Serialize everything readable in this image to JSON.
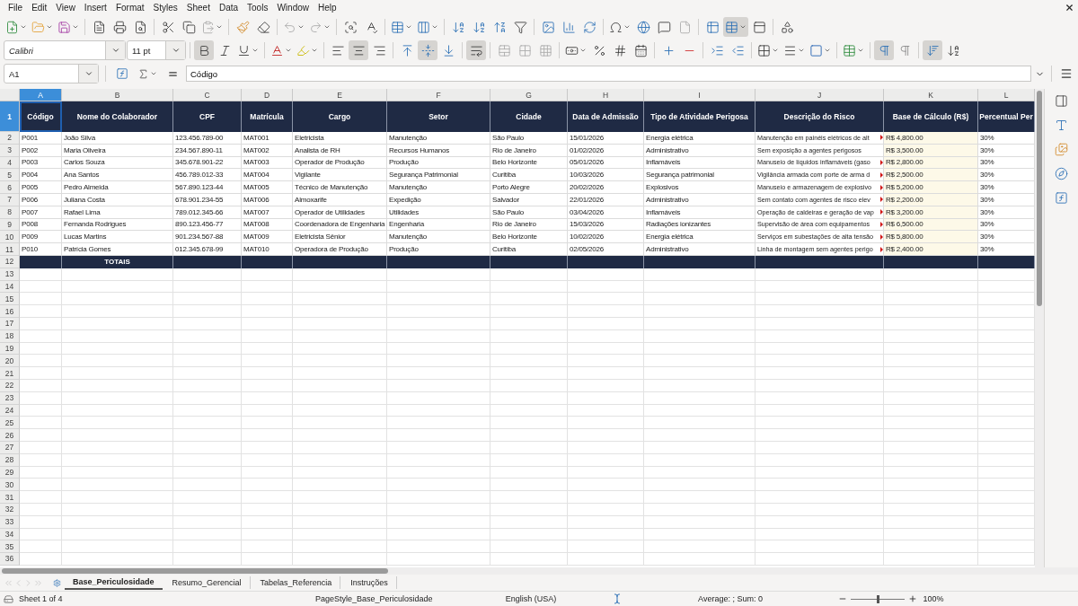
{
  "menu": [
    "File",
    "Edit",
    "View",
    "Insert",
    "Format",
    "Styles",
    "Sheet",
    "Data",
    "Tools",
    "Window",
    "Help"
  ],
  "format": {
    "font": "Calibri",
    "size": "11 pt",
    "bold": true,
    "italic": false,
    "underline": false,
    "align_center": true,
    "valign_middle": true,
    "wrap_text": true,
    "left_to_right": true
  },
  "name_box": "A1",
  "formula": "Código",
  "columns": [
    {
      "label": "A",
      "selected": true
    },
    {
      "label": "B",
      "selected": false
    },
    {
      "label": "C",
      "selected": false
    },
    {
      "label": "D",
      "selected": false
    },
    {
      "label": "E",
      "selected": false
    },
    {
      "label": "F",
      "selected": false
    },
    {
      "label": "G",
      "selected": false
    },
    {
      "label": "H",
      "selected": false
    },
    {
      "label": "I",
      "selected": false
    },
    {
      "label": "J",
      "selected": false
    },
    {
      "label": "K",
      "selected": false
    },
    {
      "label": "L",
      "selected": false
    }
  ],
  "header_row": {
    "number": "1",
    "selected": true,
    "cells": [
      "Código",
      "Nome do Colaborador",
      "CPF",
      "Matrícula",
      "Cargo",
      "Setor",
      "Cidade",
      "Data de Admissão",
      "Tipo de Atividade Perigosa",
      "Descrição do Risco",
      "Base de Cálculo (R$)",
      "Percentual Per"
    ]
  },
  "rows": [
    {
      "number": "2",
      "clipped": true,
      "cells": [
        "P001",
        "João Silva",
        "123.456.789-00",
        "MAT001",
        "Eletricista",
        "Manutenção",
        "São Paulo",
        "15/01/2026",
        "Energia elétrica",
        "Manutenção em painéis elétricos de alt",
        "R$ 4,800.00",
        "30%"
      ]
    },
    {
      "number": "3",
      "clipped": false,
      "cells": [
        "P002",
        "Maria Oliveira",
        "234.567.890-11",
        "MAT002",
        "Analista de RH",
        "Recursos Humanos",
        "Rio de Janeiro",
        "01/02/2026",
        "Administrativo",
        "Sem exposição a agentes perigosos",
        "R$ 3,500.00",
        "30%"
      ]
    },
    {
      "number": "4",
      "clipped": true,
      "cells": [
        "P003",
        "Carlos Souza",
        "345.678.901-22",
        "MAT003",
        "Operador de Produção",
        "Produção",
        "Belo Horizonte",
        "05/01/2026",
        "Inflamáveis",
        "Manuseio de líquidos inflamáveis (gaso",
        "R$ 2,800.00",
        "30%"
      ]
    },
    {
      "number": "5",
      "clipped": true,
      "cells": [
        "P004",
        "Ana Santos",
        "456.789.012-33",
        "MAT004",
        "Vigilante",
        "Segurança Patrimonial",
        "Curitiba",
        "10/03/2026",
        "Segurança patrimonial",
        "Vigilância armada com porte de arma d",
        "R$ 2,500.00",
        "30%"
      ]
    },
    {
      "number": "6",
      "clipped": true,
      "cells": [
        "P005",
        "Pedro Almeida",
        "567.890.123-44",
        "MAT005",
        "Técnico de Manutenção",
        "Manutenção",
        "Porto Alegre",
        "20/02/2026",
        "Explosivos",
        "Manuseio e armazenagem de explosivo",
        "R$ 5,200.00",
        "30%"
      ]
    },
    {
      "number": "7",
      "clipped": true,
      "cells": [
        "P006",
        "Juliana Costa",
        "678.901.234-55",
        "MAT006",
        "Almoxarife",
        "Expedição",
        "Salvador",
        "22/01/2026",
        "Administrativo",
        "Sem contato com agentes de risco elev",
        "R$ 2,200.00",
        "30%"
      ]
    },
    {
      "number": "8",
      "clipped": true,
      "cells": [
        "P007",
        "Rafael Lima",
        "789.012.345-66",
        "MAT007",
        "Operador de Utilidades",
        "Utilidades",
        "São Paulo",
        "03/04/2026",
        "Inflamáveis",
        "Operação de caldeiras e geração de vap",
        "R$ 3,200.00",
        "30%"
      ]
    },
    {
      "number": "9",
      "clipped": true,
      "cells": [
        "P008",
        "Fernanda Rodrigues",
        "890.123.456-77",
        "MAT008",
        "Coordenadora de Engenharia",
        "Engenharia",
        "Rio de Janeiro",
        "15/03/2026",
        "Radiações ionizantes",
        "Supervisão de área com equipamentos",
        "R$ 6,500.00",
        "30%"
      ]
    },
    {
      "number": "10",
      "clipped": true,
      "cells": [
        "P009",
        "Lucas Martins",
        "901.234.567-88",
        "MAT009",
        "Eletricista Sênior",
        "Manutenção",
        "Belo Horizonte",
        "10/02/2026",
        "Energia elétrica",
        "Serviços em subestações de alta tensão",
        "R$ 5,800.00",
        "30%"
      ]
    },
    {
      "number": "11",
      "clipped": true,
      "cells": [
        "P010",
        "Patrícia Gomes",
        "012.345.678-99",
        "MAT010",
        "Operadora de Produção",
        "Produção",
        "Curitiba",
        "02/05/2026",
        "Administrativo",
        "Linha de montagem sem agentes perigo",
        "R$ 2,400.00",
        "30%"
      ]
    }
  ],
  "totals_row": {
    "number": "12",
    "label": "TOTAIS"
  },
  "empty_rows": [
    "13",
    "14",
    "15",
    "16",
    "17",
    "18",
    "19",
    "20",
    "21",
    "22",
    "23",
    "24",
    "25",
    "26",
    "27",
    "28",
    "29",
    "30",
    "31",
    "32",
    "33",
    "34",
    "35",
    "36"
  ],
  "sheet_tabs": [
    {
      "label": "Base_Periculosidade",
      "selected": true
    },
    {
      "label": "Resumo_Gerencial",
      "selected": false
    },
    {
      "label": "Tabelas_Referencia",
      "selected": false
    },
    {
      "label": "Instruções",
      "selected": false
    }
  ],
  "status_bar": {
    "sheet": "Sheet 1 of 4",
    "page_style": "PageStyle_Base_Periculosidade",
    "language": "English (USA)",
    "summary": "Average: ; Sum: 0",
    "zoom": "100%",
    "zoom_level": {
      "level": 0.5
    }
  }
}
